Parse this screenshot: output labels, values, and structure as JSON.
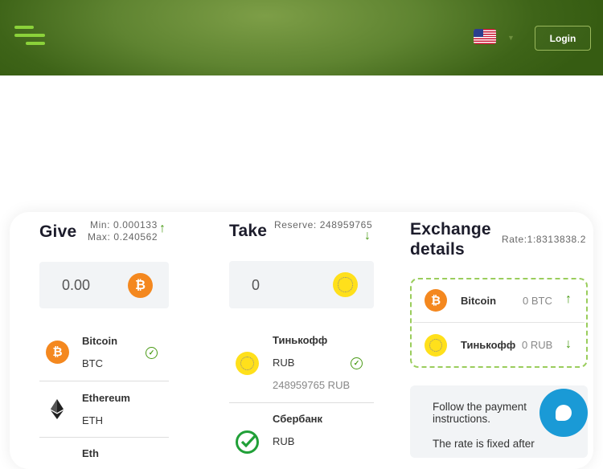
{
  "header": {
    "login_label": "Login",
    "language": "en-US flag"
  },
  "give": {
    "title": "Give",
    "min": "Min: 0.000133",
    "max": "Max: 0.240562",
    "amount": "0.00",
    "currencies": [
      {
        "name": "Bitcoin",
        "code": "BTC",
        "selected": true
      },
      {
        "name": "Ethereum",
        "code": "ETH",
        "selected": false
      },
      {
        "name": "Eth",
        "code": "",
        "selected": false
      }
    ]
  },
  "take": {
    "title": "Take",
    "reserve": "Reserve: 248959765",
    "amount": "0",
    "currencies": [
      {
        "name": "Тинькофф",
        "code": "RUB",
        "reserve": "248959765 RUB",
        "selected": true
      },
      {
        "name": "Сбербанк",
        "code": "RUB",
        "selected": false
      }
    ]
  },
  "details": {
    "title_line1": "Exchange",
    "title_line2": "details",
    "rate": "Rate:1:8313838.2",
    "give_row": {
      "name": "Bitcoin",
      "amount": "0 BTC"
    },
    "take_row": {
      "name": "Тинькофф",
      "amount": "0 RUB"
    },
    "info_line1": "Follow the payment",
    "info_line2": "instructions.",
    "info_line3": "The rate is fixed after"
  },
  "colors": {
    "accent_green": "#4a9b16",
    "bitcoin_orange": "#f4881f",
    "tinkoff_yellow": "#ffe01b",
    "chat_blue": "#1a9ad6"
  }
}
